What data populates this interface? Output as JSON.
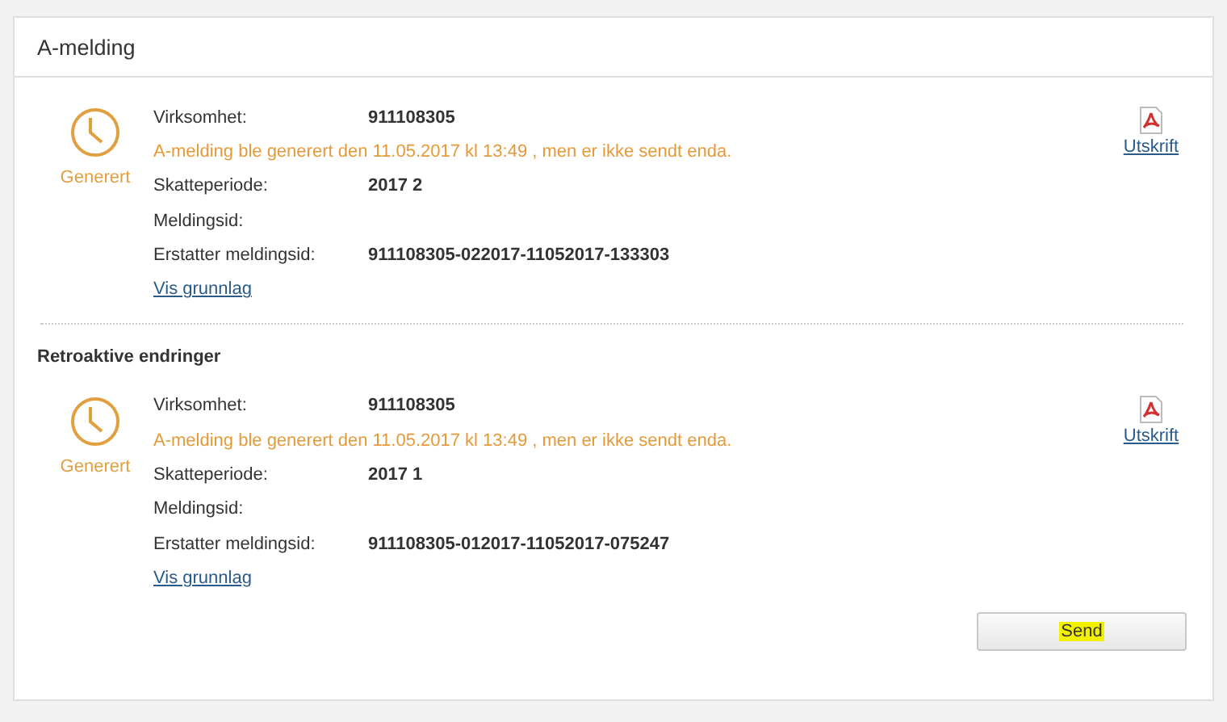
{
  "panel": {
    "title": "A-melding"
  },
  "sections": [
    {
      "status": "Generert",
      "print_link": "Utskrift",
      "rows": [
        {
          "kind": "field",
          "label": "Virksomhet:",
          "value": "911108305"
        },
        {
          "kind": "message",
          "text": "A-melding ble generert den 11.05.2017 kl 13:49 , men er ikke sendt enda."
        },
        {
          "kind": "field",
          "label": "Skatteperiode:",
          "value": "2017 2"
        },
        {
          "kind": "field",
          "label": "Meldingsid:"
        },
        {
          "kind": "field",
          "label": "Erstatter meldingsid:",
          "value": "911108305-022017-11052017-133303"
        }
      ],
      "link": "Vis grunnlag"
    },
    {
      "heading": "Retroaktive endringer",
      "status": "Generert",
      "print_link": "Utskrift",
      "rows": [
        {
          "kind": "field",
          "label": "Virksomhet:",
          "value": "911108305"
        },
        {
          "kind": "message",
          "text": "A-melding ble generert den 11.05.2017 kl 13:49 , men er ikke sendt enda."
        },
        {
          "kind": "field",
          "label": "Skatteperiode:",
          "value": "2017 1"
        },
        {
          "kind": "field",
          "label": "Meldingsid:"
        },
        {
          "kind": "field",
          "label": "Erstatter meldingsid:",
          "value": "911108305-012017-11052017-075247"
        }
      ],
      "link": "Vis grunnlag"
    }
  ],
  "send_button": {
    "label": "Send",
    "highlighted": true
  }
}
